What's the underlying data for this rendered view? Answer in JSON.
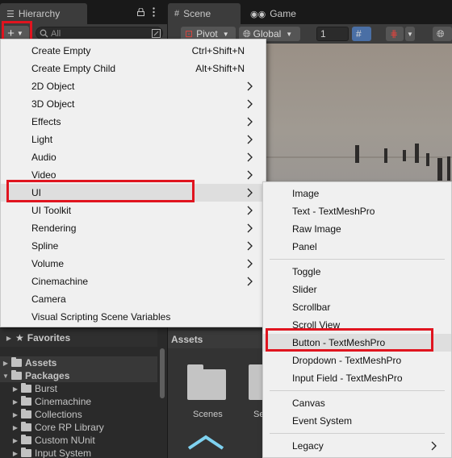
{
  "tabs": {
    "hierarchy_label": "Hierarchy",
    "scene_label": "Scene",
    "game_label": "Game"
  },
  "hierarchy_toolbar": {
    "search_placeholder": "All"
  },
  "scene_toolbar": {
    "pivot_label": "Pivot",
    "global_label": "Global",
    "snap_value": "1"
  },
  "create_menu": {
    "items": [
      {
        "label": "Create Empty",
        "shortcut": "Ctrl+Shift+N"
      },
      {
        "label": "Create Empty Child",
        "shortcut": "Alt+Shift+N"
      },
      {
        "label": "2D Object"
      },
      {
        "label": "3D Object"
      },
      {
        "label": "Effects"
      },
      {
        "label": "Light"
      },
      {
        "label": "Audio"
      },
      {
        "label": "Video"
      },
      {
        "label": "UI"
      },
      {
        "label": "UI Toolkit"
      },
      {
        "label": "Rendering"
      },
      {
        "label": "Spline"
      },
      {
        "label": "Volume"
      },
      {
        "label": "Cinemachine"
      },
      {
        "label": "Camera"
      },
      {
        "label": "Visual Scripting Scene Variables"
      }
    ]
  },
  "ui_submenu": {
    "items": [
      {
        "label": "Image"
      },
      {
        "label": "Text - TextMeshPro"
      },
      {
        "label": "Raw Image"
      },
      {
        "label": "Panel"
      },
      {
        "label": "Toggle"
      },
      {
        "label": "Slider"
      },
      {
        "label": "Scrollbar"
      },
      {
        "label": "Scroll View"
      },
      {
        "label": "Button - TextMeshPro"
      },
      {
        "label": "Dropdown - TextMeshPro"
      },
      {
        "label": "Input Field - TextMeshPro"
      },
      {
        "label": "Canvas"
      },
      {
        "label": "Event System"
      },
      {
        "label": "Legacy"
      }
    ]
  },
  "project": {
    "favorites_label": "Favorites",
    "tree": [
      {
        "label": "Assets"
      },
      {
        "label": "Packages"
      },
      {
        "label": "Burst"
      },
      {
        "label": "Cinemachine"
      },
      {
        "label": "Collections"
      },
      {
        "label": "Core RP Library"
      },
      {
        "label": "Custom NUnit"
      },
      {
        "label": "Input System"
      }
    ],
    "assets_header": "Assets",
    "asset_items": [
      {
        "label": "Scenes"
      },
      {
        "label": "Se"
      }
    ]
  },
  "colors": {
    "highlight_red": "#e0141f",
    "menu_bg": "#f0f0f0",
    "editor_dark": "#191919",
    "panel_grey": "#3c3c3c"
  }
}
